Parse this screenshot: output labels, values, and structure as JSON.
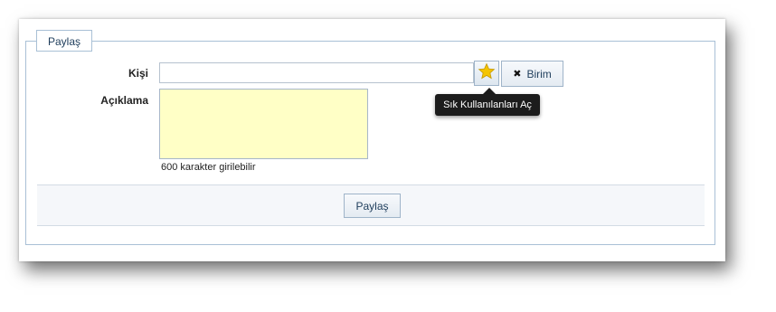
{
  "panel": {
    "legend": "Paylaş"
  },
  "form": {
    "kisi_label": "Kişi",
    "kisi_value": "",
    "aciklama_label": "Açıklama",
    "aciklama_value": "",
    "counter_text": "600 karakter girilebilir"
  },
  "buttons": {
    "favorites_icon": "star-icon",
    "birim_label": "Birim",
    "birim_icon": "close-icon",
    "submit_label": "Paylaş"
  },
  "tooltip": {
    "text": "Sık Kullanılanları Aç"
  },
  "colors": {
    "textarea_bg": "#ffffc6",
    "border": "#a9c0d6",
    "star": "#f4c400",
    "tooltip_bg": "#1c1c1c"
  }
}
